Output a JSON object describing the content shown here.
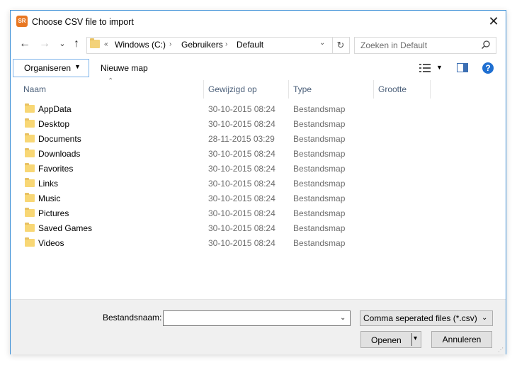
{
  "window": {
    "title": "Choose CSV file to import",
    "app_icon_text": "SR"
  },
  "nav": {
    "back": "←",
    "forward": "→",
    "recent": "⌄",
    "up": "↑"
  },
  "address": {
    "overflow": "«",
    "crumbs": [
      "Windows (C:)",
      "Gebruikers",
      "Default"
    ],
    "dropdown": "⌄",
    "refresh": "↻"
  },
  "search": {
    "placeholder": "Zoeken in Default"
  },
  "toolbar": {
    "organize_label": "Organiseren",
    "organize_caret": "▼",
    "new_folder_label": "Nieuwe map",
    "view_caret": "▼",
    "help": "?"
  },
  "columns": [
    "Naam",
    "Gewijzigd op",
    "Type",
    "Grootte"
  ],
  "files": [
    {
      "name": "AppData",
      "modified": "30-10-2015 08:24",
      "type": "Bestandsmap"
    },
    {
      "name": "Desktop",
      "modified": "30-10-2015 08:24",
      "type": "Bestandsmap"
    },
    {
      "name": "Documents",
      "modified": "28-11-2015 03:29",
      "type": "Bestandsmap"
    },
    {
      "name": "Downloads",
      "modified": "30-10-2015 08:24",
      "type": "Bestandsmap"
    },
    {
      "name": "Favorites",
      "modified": "30-10-2015 08:24",
      "type": "Bestandsmap"
    },
    {
      "name": "Links",
      "modified": "30-10-2015 08:24",
      "type": "Bestandsmap"
    },
    {
      "name": "Music",
      "modified": "30-10-2015 08:24",
      "type": "Bestandsmap"
    },
    {
      "name": "Pictures",
      "modified": "30-10-2015 08:24",
      "type": "Bestandsmap"
    },
    {
      "name": "Saved Games",
      "modified": "30-10-2015 08:24",
      "type": "Bestandsmap"
    },
    {
      "name": "Videos",
      "modified": "30-10-2015 08:24",
      "type": "Bestandsmap"
    }
  ],
  "footer": {
    "filename_label": "Bestandsnaam:",
    "filename_value": "",
    "filetype": "Comma seperated files (*.csv)",
    "open_label": "Openen",
    "cancel_label": "Annuleren"
  },
  "colors": {
    "accent": "#3b8fd6",
    "folder": "#f8d775",
    "header_text": "#4c607a",
    "meta_text": "#6d6d6d"
  }
}
